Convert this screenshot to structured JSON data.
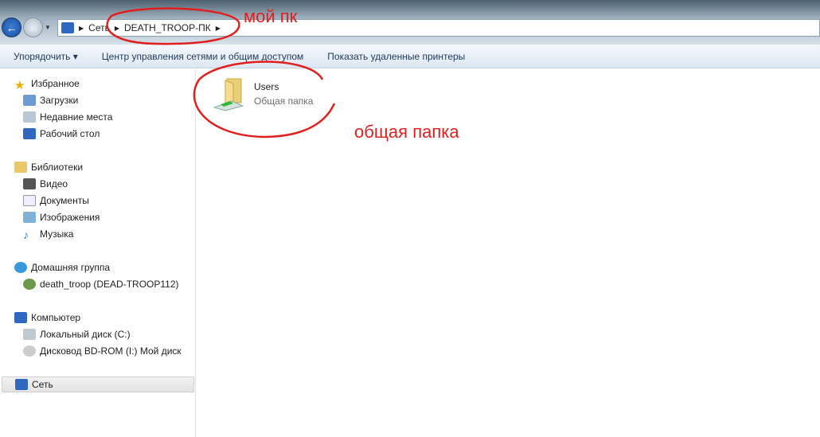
{
  "address": {
    "segments": [
      "Сеть",
      "DEATH_TROOP-ПК"
    ]
  },
  "toolbar": {
    "organize": "Упорядочить ▾",
    "network_center": "Центр управления сетями и общим доступом",
    "show_printers": "Показать удаленные принтеры"
  },
  "sidebar": {
    "favorites": {
      "label": "Избранное",
      "items": [
        "Загрузки",
        "Недавние места",
        "Рабочий стол"
      ]
    },
    "libraries": {
      "label": "Библиотеки",
      "items": [
        "Видео",
        "Документы",
        "Изображения",
        "Музыка"
      ]
    },
    "homegroup": {
      "label": "Домашняя группа",
      "items": [
        "death_troop (DEAD-TROOP112)"
      ]
    },
    "computer": {
      "label": "Компьютер",
      "items": [
        "Локальный диск (C:)",
        "Дисковод BD-ROM (I:) Мой диск"
      ]
    },
    "network": {
      "label": "Сеть"
    }
  },
  "items": [
    {
      "name": "Users",
      "type": "Общая папка"
    }
  ],
  "annotations": {
    "my_pc": "мой пк",
    "shared_folder": "общая папка"
  }
}
